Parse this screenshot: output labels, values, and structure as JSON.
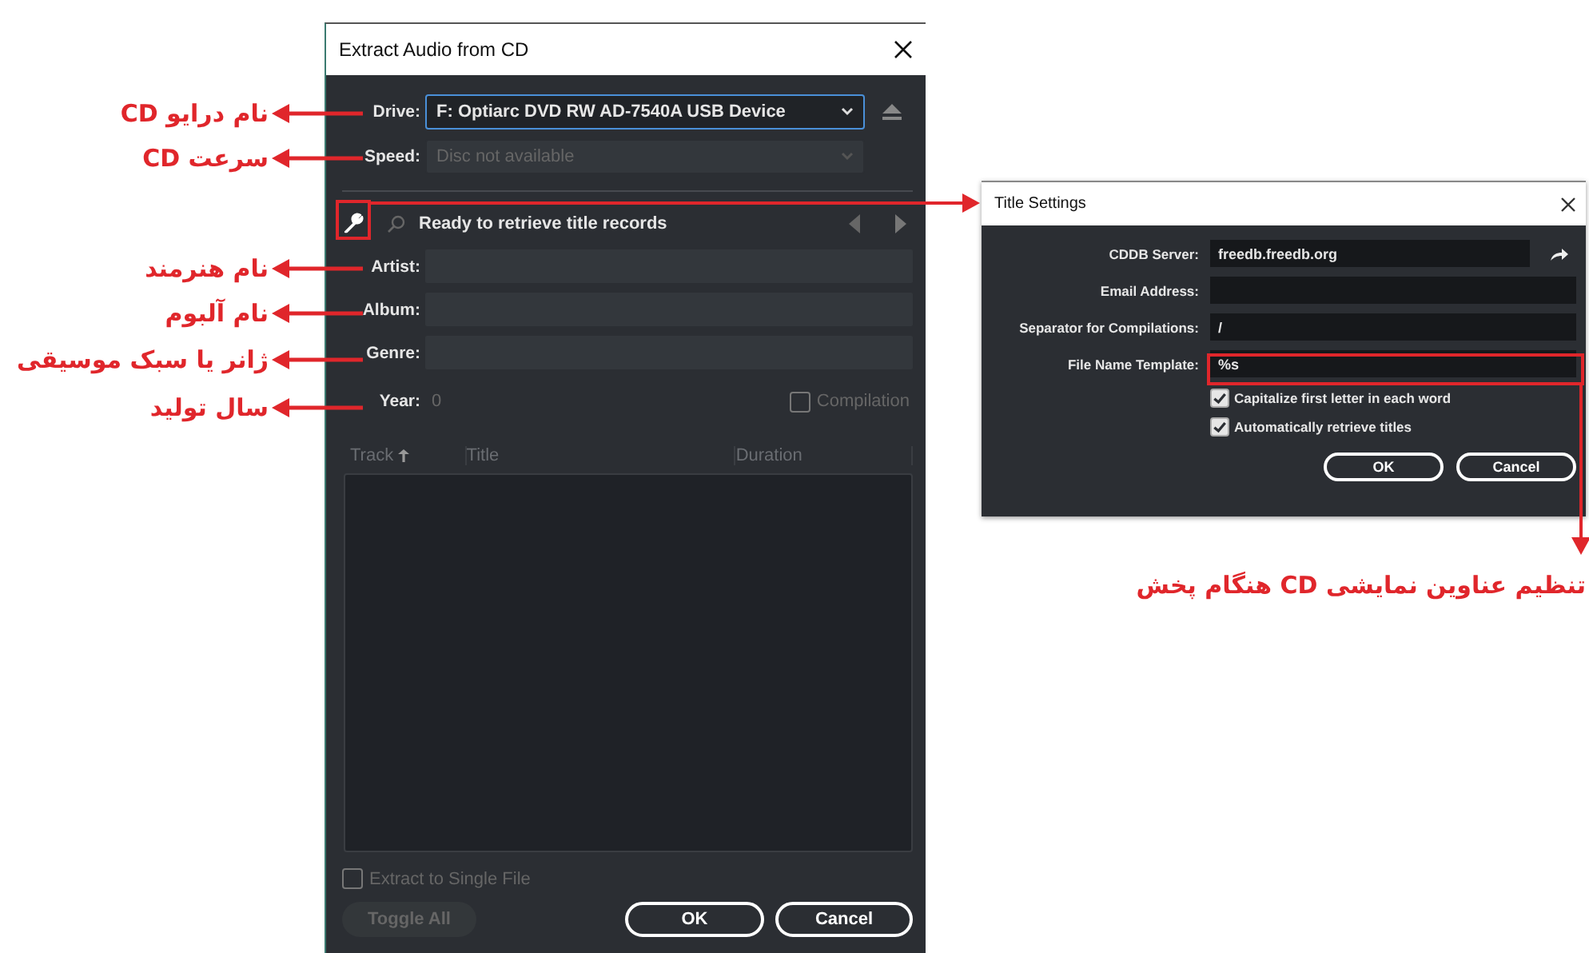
{
  "extract_dialog": {
    "title": "Extract Audio from CD",
    "drive": {
      "label": "Drive:",
      "value": "F: Optiarc DVD RW AD-7540A USB Device"
    },
    "speed": {
      "label": "Speed:",
      "value": "Disc not available",
      "disabled": true
    },
    "status": "Ready to retrieve title records",
    "fields": [
      {
        "label": "Artist:"
      },
      {
        "label": "Album:"
      },
      {
        "label": "Genre:"
      }
    ],
    "year": {
      "label": "Year:",
      "value": "0"
    },
    "compilation": {
      "label": "Compilation",
      "checked": false
    },
    "columns": [
      {
        "label": "Track",
        "sorted": true
      },
      {
        "label": "Title",
        "sorted": false
      },
      {
        "label": "Duration",
        "sorted": false
      }
    ],
    "single_file": {
      "label": "Extract to Single File",
      "checked": false
    },
    "buttons": [
      {
        "label": "Toggle All",
        "disabled": true
      },
      {
        "label": "OK",
        "disabled": false
      },
      {
        "label": "Cancel",
        "disabled": false
      }
    ]
  },
  "title_settings": {
    "title": "Title Settings",
    "fields": [
      {
        "label": "CDDB Server:",
        "value": "freedb.freedb.org"
      },
      {
        "label": "Email Address:"
      },
      {
        "label": "Separator for Compilations:",
        "value": "/"
      },
      {
        "label": "File Name Template:",
        "value": "%s"
      }
    ],
    "options": [
      {
        "label": "Capitalize first letter in each word",
        "checked": true
      },
      {
        "label": "Automatically retrieve titles",
        "checked": true
      }
    ],
    "buttons": [
      "OK",
      "Cancel"
    ]
  },
  "annotations": [
    {
      "kind": "side",
      "text": "نام درایو CD"
    },
    {
      "kind": "side",
      "text": "سرعت CD"
    },
    {
      "kind": "side",
      "text": "نام هنرمند"
    },
    {
      "kind": "side",
      "text": "نام آلبوم"
    },
    {
      "kind": "side",
      "text": "ژانر یا سبک موسیقی"
    },
    {
      "kind": "side",
      "text": "سال تولید"
    },
    {
      "kind": "callout",
      "text": "تنظیم عناوین نمایشی CD هنگام پخش"
    }
  ]
}
